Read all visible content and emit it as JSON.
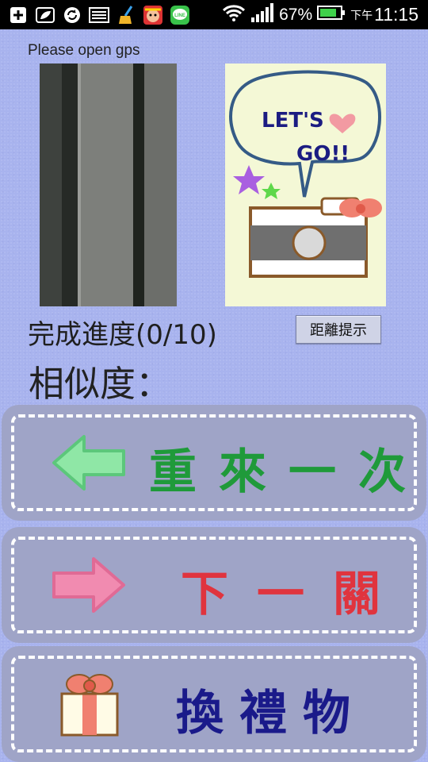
{
  "status_bar": {
    "battery": "67%",
    "time_prefix": "下午",
    "time": "11:15",
    "icons": [
      "add-icon",
      "leaf-icon",
      "sync-icon",
      "keyboard-icon",
      "broom-icon",
      "game-avatar-icon",
      "line-app-icon",
      "wifi-icon",
      "signal-icon",
      "battery-icon"
    ]
  },
  "gps_message": "Please open gps",
  "game_panel": {
    "caption_line1": "LET'S",
    "caption_line2": "GO!!"
  },
  "progress_text": "完成進度(0/10)",
  "hint_button_label": "距離提示",
  "similarity_label": "相似度：",
  "buttons": {
    "retry": {
      "label": "重來一次",
      "color": "#1f9a3a",
      "icon": "arrow-left-icon"
    },
    "next": {
      "label": "下一關",
      "color": "#e0343e",
      "icon": "arrow-right-icon"
    },
    "gift": {
      "label": "換禮物",
      "color": "#1a1a8a",
      "icon": "gift-icon"
    }
  }
}
